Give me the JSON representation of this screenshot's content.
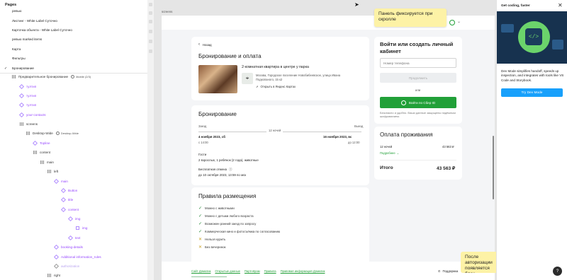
{
  "left_panel": {
    "pages_title": "Pages",
    "pages": [
      "ревью",
      "Листинг - White Label Суточно",
      "Карточка объекта - White Label Суточно",
      "ревью marked items",
      "Карта",
      "Фильтры",
      "Бронирование"
    ],
    "current_page": "Бронирование",
    "layers_header": {
      "label": "Предварительное бронирование",
      "tag": "Mobile (2/3)"
    },
    "layers": [
      "тултип",
      "тултип",
      "тултип",
      "your-contacts",
      "screens",
      "Desktop-Wide",
      "Topline",
      "content",
      "main",
      "left",
      "main",
      "Button",
      "title",
      "content",
      "img",
      "img",
      "text",
      "booking-details",
      "Additional information_rules",
      "authorization",
      "right"
    ],
    "desktop_wide_tag": "Desktop-Wide"
  },
  "canvas": {
    "frame_label": "screens",
    "tooltip_top": "Панель фиксируется при скролле",
    "tooltip_bottom": "После авторизации появляется блок \"Контактное лицо\"",
    "back_label": "Назад",
    "page_title": "Бронирование и оплата",
    "listing": {
      "title": "2-комнатная квартира в центре у парка",
      "address": "Москва, Городское поселение Новобибеевское, улица Ивана Подкопаного, 15 к2",
      "map_link": "Открыть в Яндекс Картах"
    },
    "booking": {
      "title": "Бронирование",
      "checkin_label": "Заезд",
      "checkout_label": "Выезд",
      "nights": "12 ночей",
      "checkin_date": "4 ноября 2023, сб",
      "checkin_time": "с 14:00",
      "checkout_date": "16 ноября 2023, вс",
      "checkout_time": "до 12:00",
      "guests_label": "Гости",
      "guests_value": "2 взрослых, 1 ребёнок (2 года), животные",
      "cancel_label": "Бесплатная отмена",
      "cancel_value": "до 10 октября 2023, 13:59 по мск"
    },
    "rules": {
      "title": "Правила размещения",
      "items": [
        {
          "text": "Можно с животными",
          "allowed": true
        },
        {
          "text": "Можно с детьми любого возраста",
          "allowed": true
        },
        {
          "text": "Возможен ранний заезд по запросу",
          "allowed": true
        },
        {
          "text": "Коммерческая кино и фотосъёмка по согласованию",
          "allowed": true
        },
        {
          "text": "Нельзя курить",
          "allowed": false
        },
        {
          "text": "Без вечеринок",
          "allowed": false
        }
      ]
    },
    "auth": {
      "title": "Войти или создать личный кабинет",
      "phone_placeholder": "Номер телефона",
      "continue": "Продолжить",
      "or": "или",
      "sber": "Войти по Сбер ID",
      "note": "Безопасно и удобно. Ваши данные защищены надёжным шифрованием."
    },
    "payment": {
      "title": "Оплата проживания",
      "nights_label": "12 ночей",
      "nights_value": "43 563 ₽",
      "details": "Подробнее",
      "total_label": "Итого",
      "total_value": "43 563 ₽"
    },
    "footer": {
      "links": [
        "Сайт Домклик",
        "Открытые данные",
        "Партнёрам",
        "Правила",
        "Правовая информация Домклик"
      ],
      "support": "Поддержка"
    }
  },
  "right_panel": {
    "title": "Get coding, faster",
    "description": "Dev Mode simplifies handoff, speeds up inspection, and integrates with tools like VS Code and Storybook.",
    "button": "Try Dev Mode"
  },
  "colors": {
    "accent": "#21a038",
    "figma_blue": "#18a0fb",
    "tooltip": "#fdf2a6",
    "purple": "#9747ff"
  }
}
